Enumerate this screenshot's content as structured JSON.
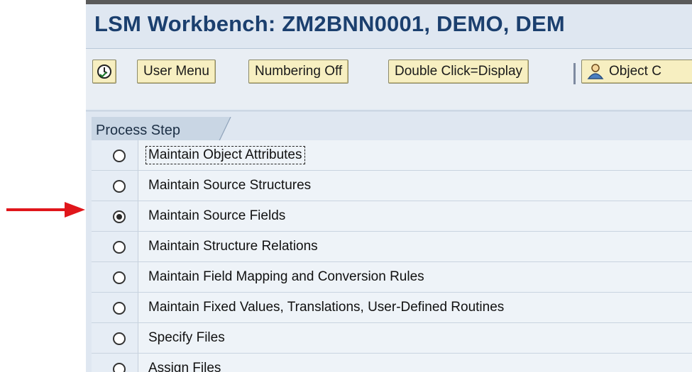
{
  "window": {
    "title": "LSM Workbench: ZM2BNN0001, DEMO, DEM"
  },
  "toolbar": {
    "items": [
      {
        "type": "icon",
        "icon": "clock-check-icon",
        "label": ""
      },
      {
        "type": "button",
        "label": "User Menu"
      },
      {
        "type": "button",
        "label": "Numbering Off"
      },
      {
        "type": "button",
        "label": "Double Click=Display"
      },
      {
        "type": "button",
        "icon": "object-overview-icon",
        "label": "Object C"
      }
    ]
  },
  "table": {
    "column_header": "Process Step",
    "rows": [
      {
        "label": "Maintain Object Attributes",
        "selected": false,
        "focused": true
      },
      {
        "label": "Maintain Source Structures",
        "selected": false,
        "focused": false
      },
      {
        "label": "Maintain Source Fields",
        "selected": true,
        "focused": false
      },
      {
        "label": "Maintain Structure Relations",
        "selected": false,
        "focused": false
      },
      {
        "label": "Maintain Field Mapping and Conversion Rules",
        "selected": false,
        "focused": false
      },
      {
        "label": "Maintain Fixed Values, Translations, User-Defined Routines",
        "selected": false,
        "focused": false
      },
      {
        "label": "Specify Files",
        "selected": false,
        "focused": false
      },
      {
        "label": "Assign Files",
        "selected": false,
        "focused": false
      }
    ]
  },
  "annotation": {
    "arrow_color": "#e0161b",
    "points_to_row": 3
  }
}
